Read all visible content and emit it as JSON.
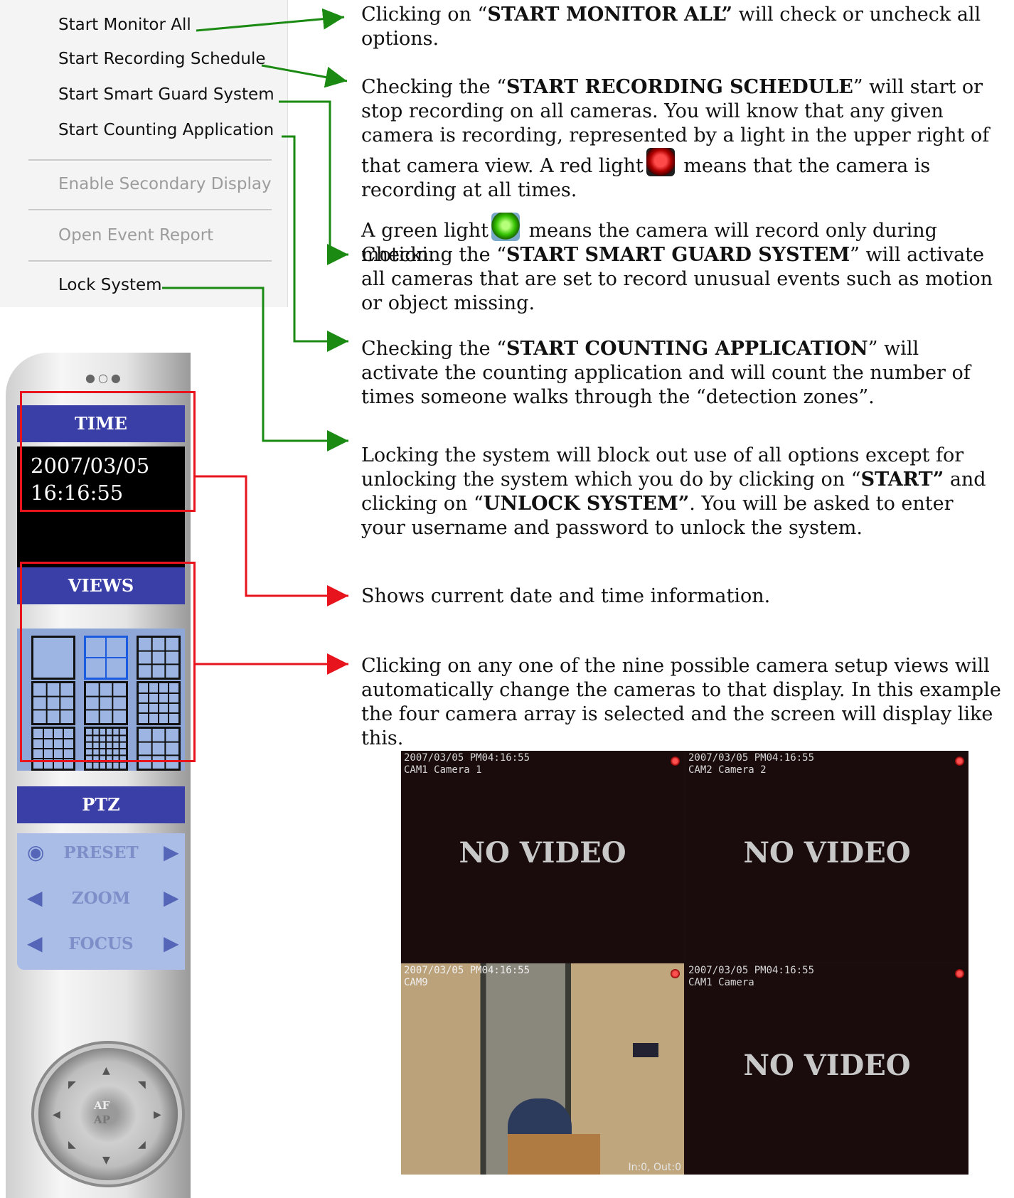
{
  "menu": {
    "items": [
      {
        "label": "Start Monitor All",
        "enabled": true
      },
      {
        "label": "Start Recording Schedule",
        "enabled": true
      },
      {
        "label": "Start Smart Guard System",
        "enabled": true
      },
      {
        "label": "Start Counting Application",
        "enabled": true
      },
      {
        "label": "Enable Secondary Display",
        "enabled": false
      },
      {
        "label": "Open Event Report",
        "enabled": false
      },
      {
        "label": "Lock System",
        "enabled": true
      }
    ]
  },
  "descriptions": {
    "monitor_all": {
      "pre": "Clicking on “",
      "bold": "START MONITOR ALL”",
      "post": " will check or uncheck all options."
    },
    "recording": {
      "pre": "Checking the “",
      "bold": "START RECORDING SCHEDULE",
      "post": "” will start or stop recording on all cameras. You will know that any given camera is recording, represented by a light in the upper right of that camera view. A red light",
      "red_tail": " means that the camera is recording at all times.",
      "green_pre": "A green light",
      "green_tail": " means the camera will record only during motion."
    },
    "smart_guard": {
      "pre": "Checking the “",
      "bold": "START SMART GUARD SYSTEM",
      "post": "” will activate all cameras that are set to record unusual events such as motion or object missing."
    },
    "counting": {
      "pre": "Checking the “",
      "bold": "START COUNTING APPLICATION",
      "post": "” will activate the counting application and will count the number of times someone walks through the “detection zones”."
    },
    "lock": {
      "pre": "Locking the system will block out use of all options except for unlocking the system which you do by clicking on “",
      "bold1": "START”",
      "mid": " and clicking on “",
      "bold2": "UNLOCK SYSTEM”",
      "post": ". You will be asked to enter your username and password to unlock the system."
    },
    "time": "Shows current date and time information.",
    "views": "Clicking on any one of the nine possible camera setup views will automatically change the cameras to that display. In this example the four camera array is selected and the screen will display like this."
  },
  "panel": {
    "time_header": "TIME",
    "time_value": "2007/03/05\n16:16:55",
    "views_header": "VIEWS",
    "views_selected_index": 1,
    "ptz_header": "PTZ",
    "ptz_rows": [
      "PRESET",
      "ZOOM",
      "FOCUS"
    ],
    "dial": {
      "af": "AF",
      "ap": "AP"
    }
  },
  "cameras": [
    {
      "overlay": "2007/03/05 PM04:16:55\nCAM1 Camera 1",
      "content": "NO VIDEO"
    },
    {
      "overlay": "2007/03/05 PM04:16:55\nCAM2 Camera 2",
      "content": "NO VIDEO"
    },
    {
      "overlay": "2007/03/05 PM04:16:55\nCAM9",
      "content": "",
      "counter": "In:0, Out:0"
    },
    {
      "overlay": "2007/03/05 PM04:16:55\nCAM1 Camera",
      "content": "NO VIDEO"
    }
  ],
  "colors": {
    "arrow_green": "#1a8a12",
    "arrow_red": "#e8141d",
    "header_blue": "#3a3fa8"
  }
}
